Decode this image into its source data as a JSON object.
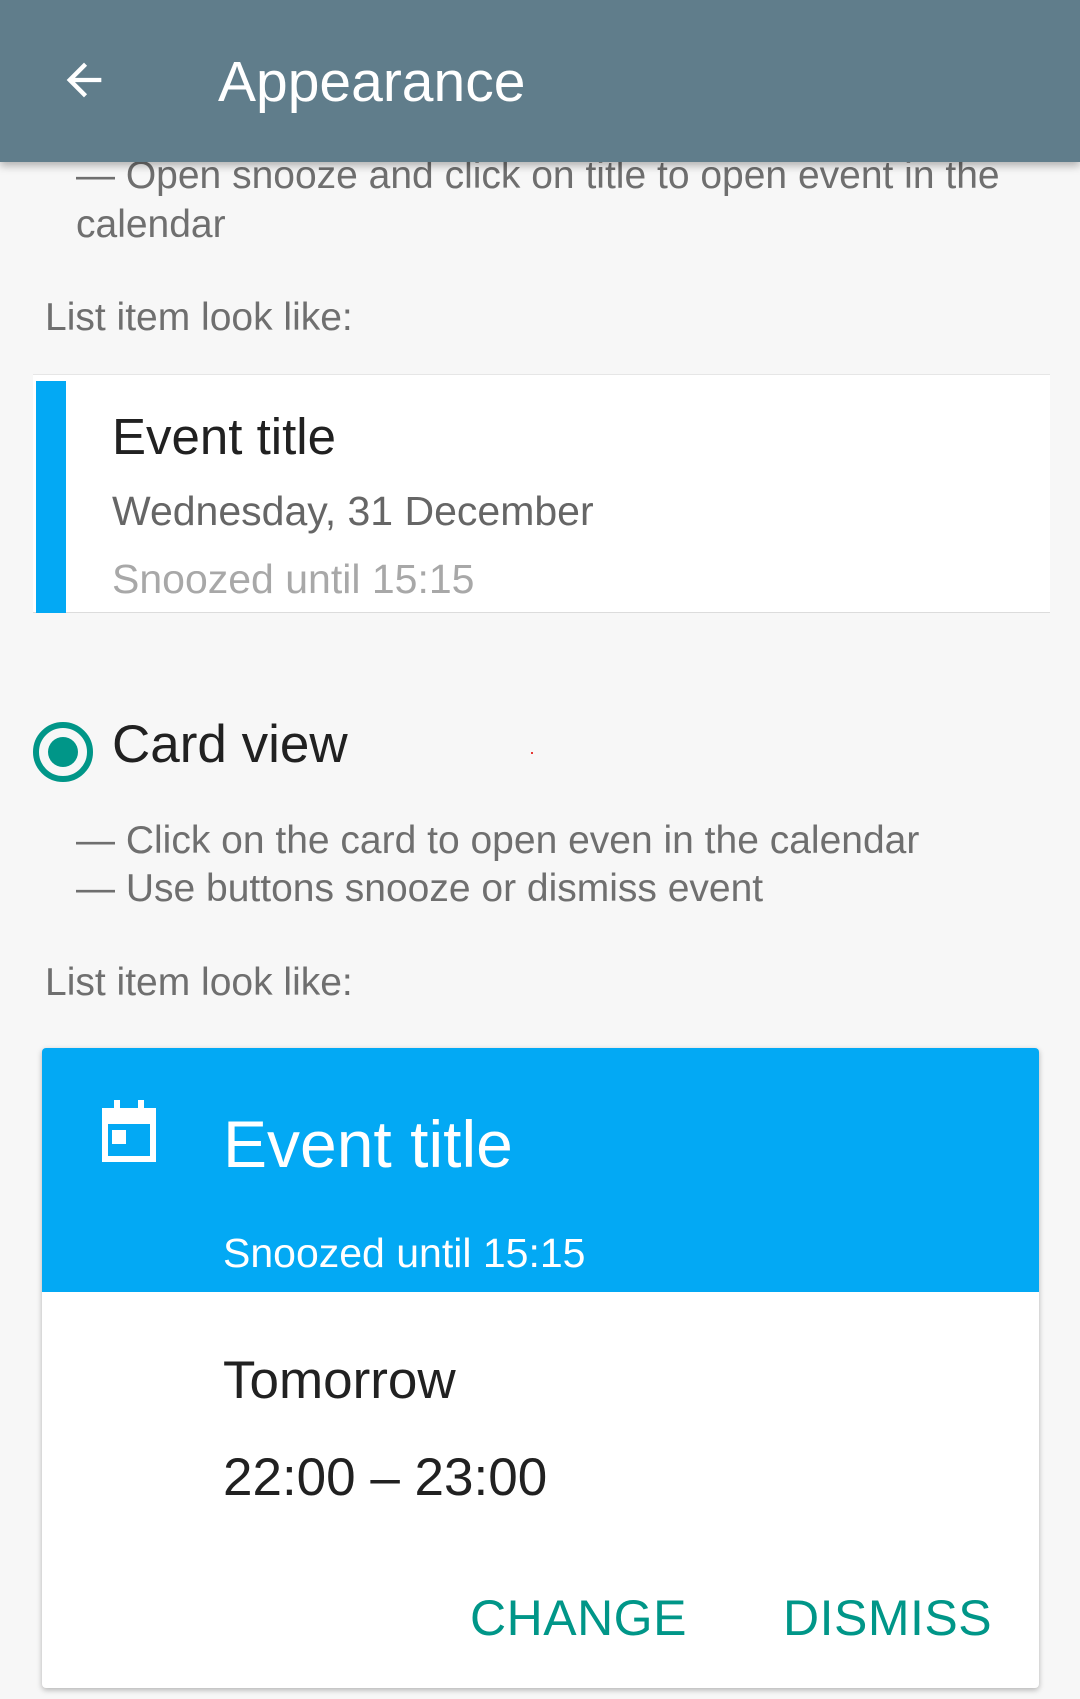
{
  "app_bar": {
    "title": "Appearance",
    "back_icon": "arrow-back-icon",
    "color": "#607d8b"
  },
  "compact_view": {
    "description_line1": "— Open snooze and click on title to open event in the",
    "description_line2": "calendar",
    "preview_label": "List item look like:",
    "preview": {
      "title": "Event title",
      "date": "Wednesday, 31 December",
      "snooze_status": "Snoozed until 15:15",
      "color": "#03a9f4"
    }
  },
  "card_view": {
    "option_label": "Card view",
    "selected": true,
    "description_line1": "— Click on the card to open even in the calendar",
    "description_line2": "— Use buttons snooze or dismiss event",
    "preview_label": "List item look like:",
    "preview": {
      "icon": "calendar-icon",
      "title": "Event title",
      "snooze_status": "Snoozed until 15:15",
      "day": "Tomorrow",
      "time_range": "22:00 – 23:00",
      "change_label": "CHANGE",
      "dismiss_label": "DISMISS",
      "header_color": "#03a9f4",
      "action_color": "#009688"
    }
  }
}
